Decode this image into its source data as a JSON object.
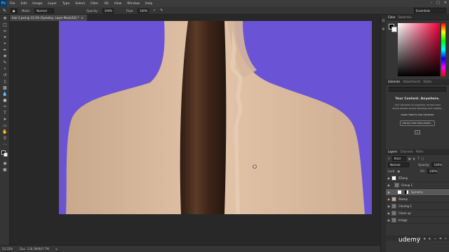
{
  "menu": {
    "logo": "Ps",
    "items": [
      "File",
      "Edit",
      "Image",
      "Layer",
      "Type",
      "Select",
      "Filter",
      "3D",
      "View",
      "Window",
      "Help"
    ]
  },
  "options": {
    "mode_label": "Mode:",
    "mode_value": "Normal",
    "opacity_label": "Opacity:",
    "opacity_value": "100%",
    "flow_label": "Flow:",
    "flow_value": "100%",
    "workspace": "Essentials"
  },
  "document": {
    "tab_title": "hair 2.psd @ 33.3% (Symetry, Layer Mask/16) *"
  },
  "status": {
    "zoom": "33.33%",
    "doc": "Doc: 128.2M/847.7M"
  },
  "color_panel": {
    "tabs": [
      "Color",
      "Swatches"
    ]
  },
  "libraries_panel": {
    "tabs": [
      "Libraries",
      "Adjustments",
      "Styles"
    ],
    "headline": "Your Content. Anywhere.",
    "body": "Use Libraries to organize, access and share assets across desktop and mobile.",
    "link": "Learn How to Use Libraries",
    "button": "Library from Document..."
  },
  "layers_panel": {
    "tabs": [
      "Layers",
      "Channels",
      "Paths"
    ],
    "kind_label": "Kind",
    "blend_mode": "Normal",
    "opacity_label": "Opacity:",
    "opacity_value": "100%",
    "lock_label": "Lock:",
    "fill_label": "Fill:",
    "fill_value": "100%",
    "layers": [
      {
        "name": "STamp"
      },
      {
        "name": "Group 1"
      },
      {
        "name": "Symetry"
      },
      {
        "name": "Stamp"
      },
      {
        "name": "Cloning 1"
      },
      {
        "name": "Clean up"
      },
      {
        "name": "Image"
      }
    ]
  },
  "watermark": "udemy",
  "colors": {
    "background_purple": "#6b53d6",
    "skin": "#d9b99d",
    "hair": "#3a241a"
  }
}
